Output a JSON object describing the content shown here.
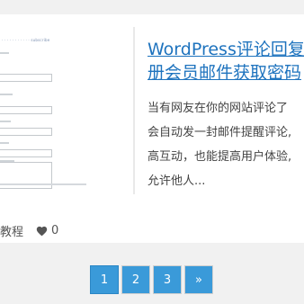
{
  "post": {
    "title_line1": "WordPress评论回复",
    "title_line2": "册会员邮件获取密码",
    "excerpt_lines": [
      "当有网友在你的网站评论了",
      "会自动发一封邮件提醒评论,",
      "高互动，也能提高用户体验,",
      "允许他人..."
    ],
    "category": "教程",
    "likes": "0"
  },
  "thumbnail": {
    "heading": "· · · · · · · · · · ·   subscribe"
  },
  "pagination": {
    "pages": [
      "1",
      "2",
      "3"
    ],
    "next": "»",
    "current": "1"
  },
  "colors": {
    "accent": "#3a9ad9",
    "title": "#1e73be",
    "background": "#f1f1f1"
  }
}
